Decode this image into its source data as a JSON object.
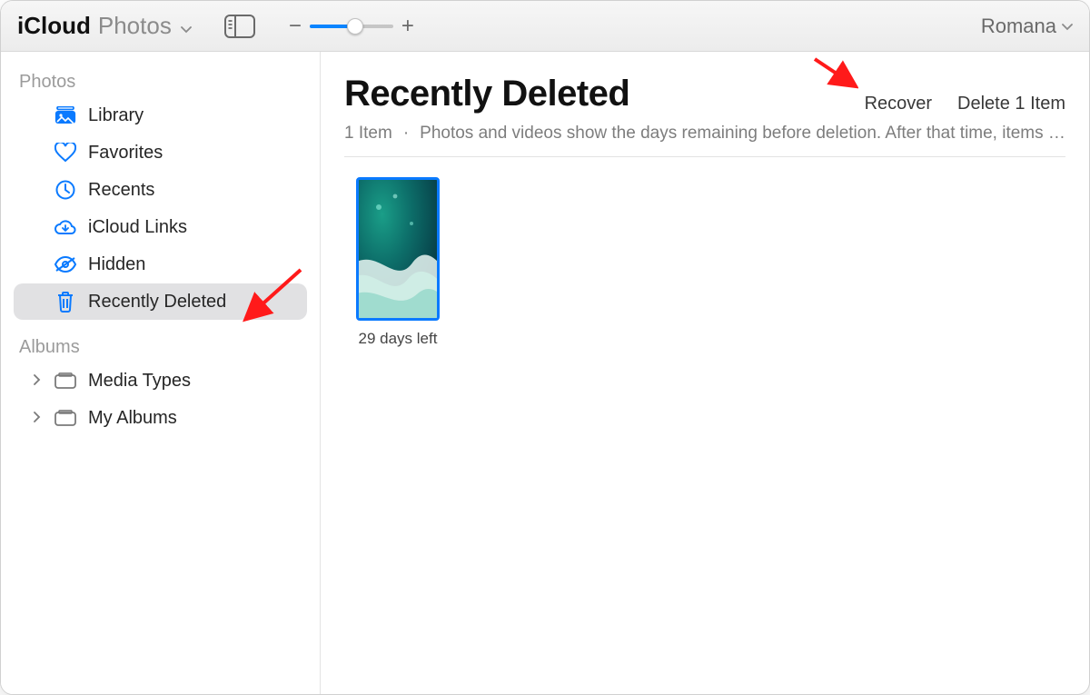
{
  "toolbar": {
    "app_bold": "iCloud",
    "app_light": "Photos",
    "account_name": "Romana",
    "zoom_percent": 55
  },
  "sidebar": {
    "sections": [
      {
        "label": "Photos",
        "items": [
          {
            "id": "library",
            "label": "Library",
            "icon": "photo-library"
          },
          {
            "id": "favorites",
            "label": "Favorites",
            "icon": "heart"
          },
          {
            "id": "recents",
            "label": "Recents",
            "icon": "clock"
          },
          {
            "id": "icloud-links",
            "label": "iCloud Links",
            "icon": "cloud"
          },
          {
            "id": "hidden",
            "label": "Hidden",
            "icon": "eye-slash"
          },
          {
            "id": "recently-deleted",
            "label": "Recently Deleted",
            "icon": "trash",
            "active": true
          }
        ]
      },
      {
        "label": "Albums",
        "items": [
          {
            "id": "media-types",
            "label": "Media Types",
            "icon": "folder",
            "disclosure": true
          },
          {
            "id": "my-albums",
            "label": "My Albums",
            "icon": "folder",
            "disclosure": true
          }
        ]
      }
    ]
  },
  "main": {
    "title": "Recently Deleted",
    "actions": {
      "recover": "Recover",
      "delete": "Delete 1 Item"
    },
    "count_label": "1 Item",
    "description": "Photos and videos show the days remaining before deletion. After that time, items …",
    "items": [
      {
        "caption": "29 days left"
      }
    ]
  }
}
